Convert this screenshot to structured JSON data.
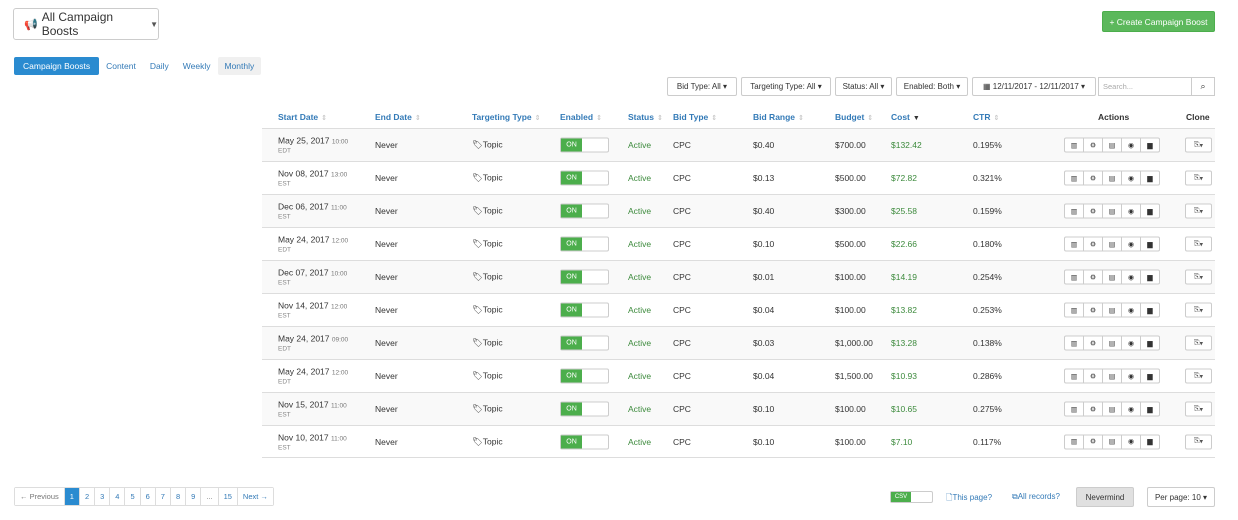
{
  "header": {
    "dropdown_label": "All Campaign Boosts",
    "create_label": "+ Create Campaign Boost"
  },
  "tabs": [
    {
      "label": "Campaign Boosts",
      "active": true
    },
    {
      "label": "Content"
    },
    {
      "label": "Daily"
    },
    {
      "label": "Weekly"
    },
    {
      "label": "Monthly"
    }
  ],
  "filters": {
    "bid_type": "Bid Type: All",
    "targeting_type": "Targeting Type: All",
    "status": "Status: All",
    "enabled": "Enabled: Both",
    "date_range": "12/11/2017 - 12/11/2017",
    "search_placeholder": "Search..."
  },
  "columns": {
    "start_date": "Start Date",
    "end_date": "End Date",
    "targeting_type": "Targeting Type",
    "enabled": "Enabled",
    "status": "Status",
    "bid_type": "Bid Type",
    "bid_range": "Bid Range",
    "budget": "Budget",
    "cost": "Cost",
    "ctr": "CTR",
    "actions": "Actions",
    "clone": "Clone"
  },
  "toggle_on_label": "ON",
  "rows": [
    {
      "date": "May 25, 2017",
      "time": "10:00",
      "tz": "EDT",
      "end": "Never",
      "targeting": "Topic",
      "status": "Active",
      "bid_type": "CPC",
      "bid_range": "$0.40",
      "budget": "$700.00",
      "cost": "$132.42",
      "ctr": "0.195%"
    },
    {
      "date": "Nov 08, 2017",
      "time": "13:00",
      "tz": "EST",
      "end": "Never",
      "targeting": "Topic",
      "status": "Active",
      "bid_type": "CPC",
      "bid_range": "$0.13",
      "budget": "$500.00",
      "cost": "$72.82",
      "ctr": "0.321%"
    },
    {
      "date": "Dec 06, 2017",
      "time": "11:00",
      "tz": "EST",
      "end": "Never",
      "targeting": "Topic",
      "status": "Active",
      "bid_type": "CPC",
      "bid_range": "$0.40",
      "budget": "$300.00",
      "cost": "$25.58",
      "ctr": "0.159%"
    },
    {
      "date": "May 24, 2017",
      "time": "12:00",
      "tz": "EDT",
      "end": "Never",
      "targeting": "Topic",
      "status": "Active",
      "bid_type": "CPC",
      "bid_range": "$0.10",
      "budget": "$500.00",
      "cost": "$22.66",
      "ctr": "0.180%"
    },
    {
      "date": "Dec 07, 2017",
      "time": "10:00",
      "tz": "EST",
      "end": "Never",
      "targeting": "Topic",
      "status": "Active",
      "bid_type": "CPC",
      "bid_range": "$0.01",
      "budget": "$100.00",
      "cost": "$14.19",
      "ctr": "0.254%"
    },
    {
      "date": "Nov 14, 2017",
      "time": "12:00",
      "tz": "EST",
      "end": "Never",
      "targeting": "Topic",
      "status": "Active",
      "bid_type": "CPC",
      "bid_range": "$0.04",
      "budget": "$100.00",
      "cost": "$13.82",
      "ctr": "0.253%"
    },
    {
      "date": "May 24, 2017",
      "time": "09:00",
      "tz": "EDT",
      "end": "Never",
      "targeting": "Topic",
      "status": "Active",
      "bid_type": "CPC",
      "bid_range": "$0.03",
      "budget": "$1,000.00",
      "cost": "$13.28",
      "ctr": "0.138%"
    },
    {
      "date": "May 24, 2017",
      "time": "12:00",
      "tz": "EDT",
      "end": "Never",
      "targeting": "Topic",
      "status": "Active",
      "bid_type": "CPC",
      "bid_range": "$0.04",
      "budget": "$1,500.00",
      "cost": "$10.93",
      "ctr": "0.286%"
    },
    {
      "date": "Nov 15, 2017",
      "time": "11:00",
      "tz": "EST",
      "end": "Never",
      "targeting": "Topic",
      "status": "Active",
      "bid_type": "CPC",
      "bid_range": "$0.10",
      "budget": "$100.00",
      "cost": "$10.65",
      "ctr": "0.275%"
    },
    {
      "date": "Nov 10, 2017",
      "time": "11:00",
      "tz": "EST",
      "end": "Never",
      "targeting": "Topic",
      "status": "Active",
      "bid_type": "CPC",
      "bid_range": "$0.10",
      "budget": "$100.00",
      "cost": "$7.10",
      "ctr": "0.117%"
    }
  ],
  "pagination": {
    "previous": "← Previous",
    "pages": [
      "1",
      "2",
      "3",
      "4",
      "5",
      "6",
      "7",
      "8",
      "9",
      "...",
      "15"
    ],
    "active_page": "1",
    "next": "Next →"
  },
  "export": {
    "csv_label": "CSV",
    "this_page": "This page?",
    "all_records": "All records?",
    "nevermind": "Nevermind",
    "per_page": "Per page: 10"
  },
  "colors": {
    "primary": "#2a8bd0",
    "success": "#5cb85c",
    "cost_green": "#3c8a3c"
  }
}
